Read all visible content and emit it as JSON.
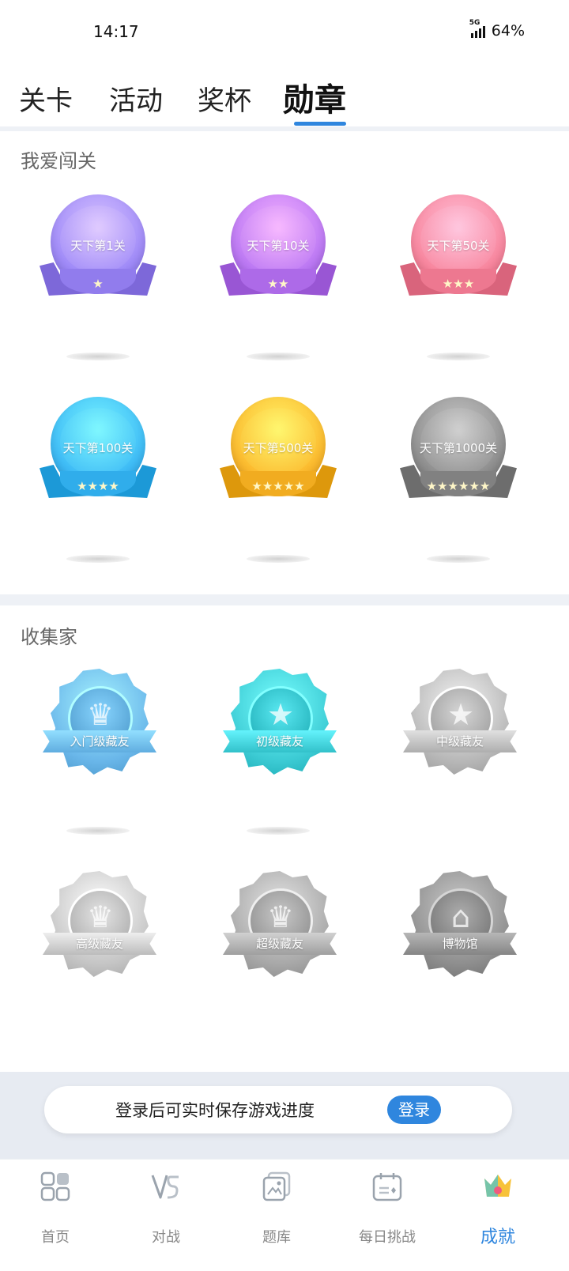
{
  "status_bar": {
    "time": "14:17",
    "network": "5G",
    "battery": "64%"
  },
  "tabs": [
    {
      "label": "关卡",
      "active": false
    },
    {
      "label": "活动",
      "active": false
    },
    {
      "label": "奖杯",
      "active": false
    },
    {
      "label": "勋章",
      "active": true
    }
  ],
  "sections": {
    "level": {
      "title": "我爱闯关",
      "badges": [
        {
          "label": "天下第1关",
          "stars": "★",
          "color": "#9b86f7"
        },
        {
          "label": "天下第10关",
          "stars": "★★",
          "color": "#b774f2"
        },
        {
          "label": "天下第50关",
          "stars": "★★★",
          "color": "#f7829a"
        },
        {
          "label": "天下第100关",
          "stars": "★★★★",
          "color": "#3ab7f5"
        },
        {
          "label": "天下第500关",
          "stars": "★★★★★",
          "color": "#fbb62a"
        },
        {
          "label": "天下第1000关",
          "stars": "★★★★★★",
          "color": "#8b8b8b"
        }
      ]
    },
    "collector": {
      "title": "收集家",
      "badges": [
        {
          "label": "入门级藏友",
          "emblem": "crown-icon",
          "color": "#6ab7ea"
        },
        {
          "label": "初级藏友",
          "emblem": "star-icon",
          "color": "#3ccbd4"
        },
        {
          "label": "中级藏友",
          "emblem": "star-icon",
          "color": "#b8b8b8"
        },
        {
          "label": "高级藏友",
          "emblem": "crown-icon",
          "color": "#c6c6c6"
        },
        {
          "label": "超级藏友",
          "emblem": "crown-icon",
          "color": "#a9a9a9"
        },
        {
          "label": "博物馆",
          "emblem": "museum-icon",
          "color": "#8f8f8f"
        }
      ]
    }
  },
  "login_banner": {
    "text": "登录后可实时保存游戏进度",
    "button": "登录"
  },
  "bottom_nav": [
    {
      "label": "首页",
      "icon": "grid-icon",
      "active": false
    },
    {
      "label": "对战",
      "icon": "vs-icon",
      "active": false
    },
    {
      "label": "题库",
      "icon": "picture-stack-icon",
      "active": false
    },
    {
      "label": "每日挑战",
      "icon": "calendar-icon",
      "active": false
    },
    {
      "label": "成就",
      "icon": "crown-icon",
      "active": true
    }
  ],
  "colors": {
    "accent": "#2f86de",
    "divider": "#eef1f6"
  }
}
